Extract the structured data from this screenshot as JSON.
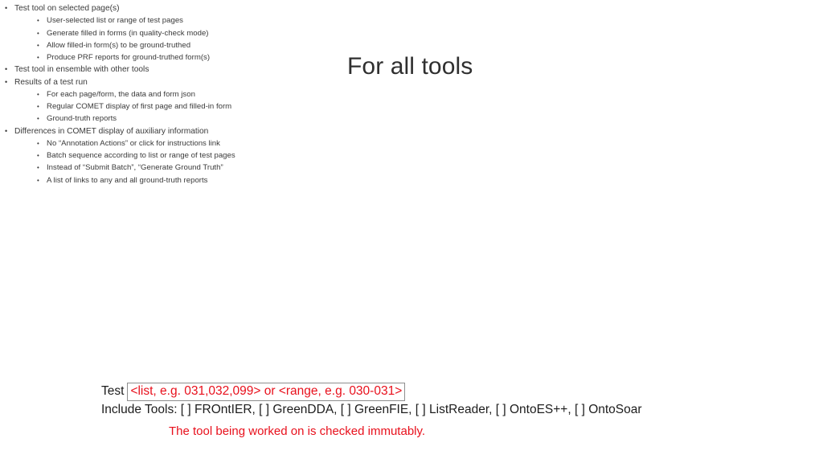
{
  "slide": {
    "title": "For all tools",
    "bullets": [
      {
        "level": 1,
        "marker": "•",
        "text": "Test tool on selected page(s)"
      },
      {
        "level": 2,
        "marker": "•",
        "text": "User-selected list or range of test pages"
      },
      {
        "level": 2,
        "marker": "•",
        "text": "Generate filled in forms (in quality-check mode)"
      },
      {
        "level": 2,
        "marker": "•",
        "text": "Allow filled-in form(s) to be ground-truthed"
      },
      {
        "level": 2,
        "marker": "•",
        "text": "Produce PRF reports for ground-truthed form(s)"
      },
      {
        "level": 1,
        "marker": "•",
        "text": "Test tool in ensemble with other tools"
      },
      {
        "level": 1,
        "marker": "•",
        "text": "Results of a test run"
      },
      {
        "level": 2,
        "marker": "•",
        "text": "For each page/form, the data and form json"
      },
      {
        "level": 2,
        "marker": "•",
        "text": "Regular COMET display of first page and filled-in form"
      },
      {
        "level": 2,
        "marker": "•",
        "text": "Ground-truth reports"
      },
      {
        "level": 1,
        "marker": "•",
        "text": "Differences in COMET display of auxiliary information"
      },
      {
        "level": 2,
        "marker": "•",
        "text": "No “Annotation Actions” or click for instructions link"
      },
      {
        "level": 2,
        "marker": "•",
        "text": "Batch sequence according to list or range of test pages"
      },
      {
        "level": 2,
        "marker": "•",
        "text": "Instead of “Submit Batch”, “Generate Ground Truth”"
      },
      {
        "level": 2,
        "marker": "•",
        "text": "A list of links to any and all ground-truth reports"
      }
    ],
    "form": {
      "test_label": "Test",
      "range_value": "<list, e.g. 031,032,099> or <range, e.g. 030-031>",
      "include_tools_line": "Include Tools: [ ] FROntIER, [ ] GreenDDA, [ ] GreenFIE, [ ] ListReader, [ ] OntoES++, [ ] OntoSoar",
      "note": "The tool being worked on is checked immutably."
    },
    "colors": {
      "body_text": "#3a3a3a",
      "title_text": "#2f2f2f",
      "accent_red": "#e8101c",
      "box_border": "#8e8e8e",
      "background": "#ffffff"
    }
  }
}
